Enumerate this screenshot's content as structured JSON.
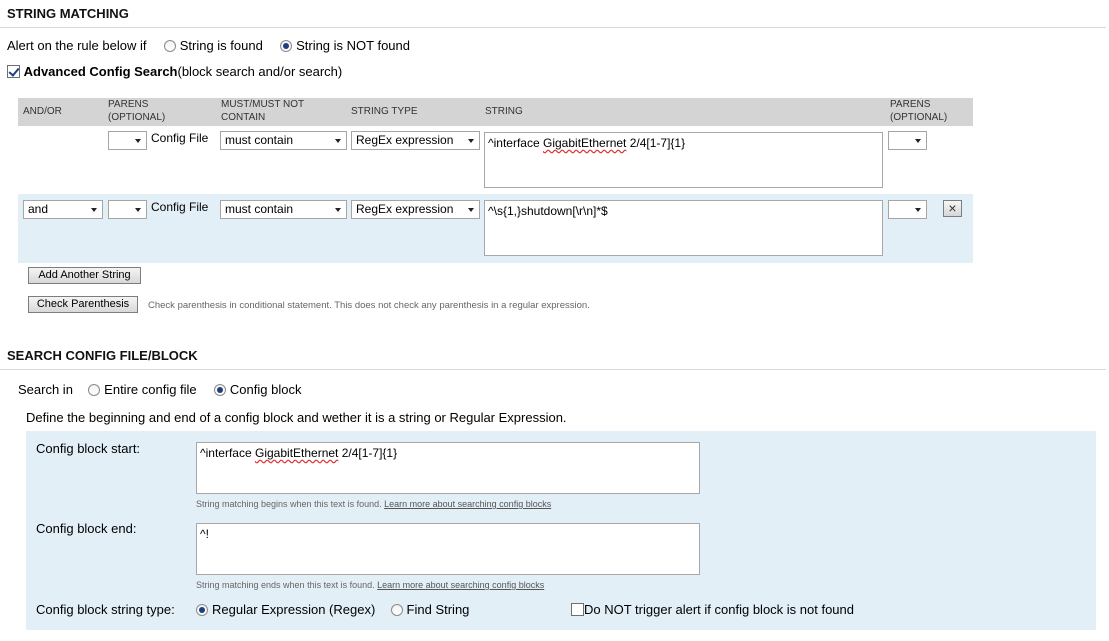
{
  "string_matching": {
    "title": "STRING MATCHING",
    "alert_prefix": "Alert on the rule below if",
    "opt_found": "String is found",
    "opt_not_found": "String is NOT found",
    "advanced_bold": "Advanced Config Search",
    "advanced_rest": "(block search and/or search)"
  },
  "table": {
    "headers": {
      "andor": "AND/OR",
      "parens1_a": "PARENS",
      "parens1_b": "(OPTIONAL)",
      "must_a": "MUST/MUST NOT",
      "must_b": "CONTAIN",
      "type": "STRING TYPE",
      "string": "STRING",
      "parens2_a": "PARENS",
      "parens2_b": "(OPTIONAL)"
    },
    "rows": [
      {
        "andor": "",
        "open_paren": "",
        "config_label": "Config File",
        "must": "must contain",
        "type": "RegEx expression",
        "string_pre": "^interface ",
        "string_sq": "GigabitEthernet",
        "string_post": " 2/4[1-7]{1}",
        "close_paren": ""
      },
      {
        "andor": "and",
        "open_paren": "",
        "config_label": "Config File",
        "must": "must contain",
        "type": "RegEx expression",
        "string_pre": "^\\s{1,}shutdown[\\r\\n]*$",
        "string_sq": "",
        "string_post": "",
        "close_paren": ""
      }
    ],
    "add_button": "Add Another String",
    "check_button": "Check Parenthesis",
    "check_hint": "Check parenthesis in conditional statement. This does not check any parenthesis in a regular expression.",
    "remove_icon": "×"
  },
  "search_config": {
    "title": "SEARCH CONFIG FILE/BLOCK",
    "search_in": "Search in",
    "opt_entire": "Entire config file",
    "opt_block": "Config block",
    "define_text": "Define the beginning and end of a config block and wether it is a string or Regular Expression.",
    "start_label": "Config block start:",
    "start_pre": "^interface ",
    "start_sq": "GigabitEthernet",
    "start_post": " 2/4[1-7]{1}",
    "start_hint": "String matching begins when this text is found. ",
    "start_link": "Learn more about searching config blocks",
    "end_label": "Config block end:",
    "end_value": "^!",
    "end_hint": "String matching ends when this text is found. ",
    "end_link": "Learn more about searching config blocks",
    "type_label": "Config block string type:",
    "opt_regex": "Regular Expression (Regex)",
    "opt_find": "Find String",
    "no_trigger": "Do NOT trigger alert if config block is not found"
  },
  "colors": {
    "header_bg": "#d4d4d4",
    "row_alt_bg": "#e3eff7",
    "panel_bg": "#e3eff7"
  }
}
